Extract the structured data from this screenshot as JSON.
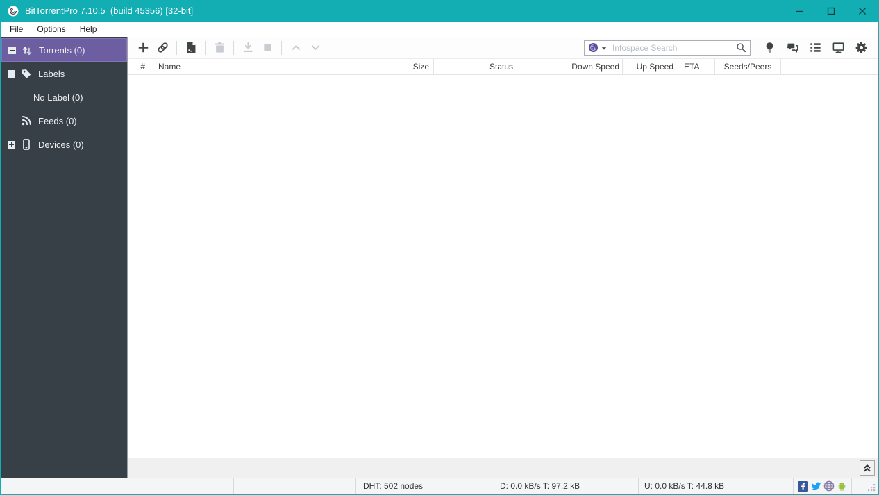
{
  "window": {
    "title": "BitTorrentPro 7.10.5  (build 45356) [32-bit]"
  },
  "menu": {
    "items": [
      {
        "label": "File"
      },
      {
        "label": "Options"
      },
      {
        "label": "Help"
      }
    ]
  },
  "sidebar": {
    "items": [
      {
        "label": "Torrents (0)",
        "icon": "updown-arrows-icon",
        "expander": "plus",
        "selected": true
      },
      {
        "label": "Labels",
        "icon": "tag-icon",
        "expander": "minus"
      },
      {
        "label": "No Label (0)",
        "icon": null,
        "indent": true
      },
      {
        "label": "Feeds (0)",
        "icon": "rss-icon"
      },
      {
        "label": "Devices (0)",
        "icon": "smartphone-icon",
        "expander": "plus"
      }
    ]
  },
  "toolbar": {
    "buttons": [
      {
        "name": "add-torrent",
        "icon": "plus-icon",
        "enabled": true
      },
      {
        "name": "add-torrent-url",
        "icon": "link-icon",
        "enabled": true
      },
      {
        "name": "create-torrent",
        "icon": "new-document-icon",
        "enabled": true
      },
      {
        "name": "remove-torrent",
        "icon": "trash-icon",
        "enabled": false
      },
      {
        "name": "start-torrent",
        "icon": "download-icon",
        "enabled": false
      },
      {
        "name": "stop-torrent",
        "icon": "stop-icon",
        "enabled": false
      },
      {
        "name": "move-up-queue",
        "icon": "chevron-up-icon",
        "enabled": false
      },
      {
        "name": "move-down-queue",
        "icon": "chevron-down-icon",
        "enabled": false
      }
    ],
    "search": {
      "placeholder": "Infospace Search",
      "value": ""
    },
    "right_buttons": [
      {
        "name": "remote",
        "icon": "lightbulb-icon"
      },
      {
        "name": "chat",
        "icon": "chat-bubbles-icon"
      },
      {
        "name": "detailed-info",
        "icon": "list-icon"
      },
      {
        "name": "devices-playback",
        "icon": "monitor-icon"
      },
      {
        "name": "preferences",
        "icon": "gear-icon"
      }
    ]
  },
  "table": {
    "columns": [
      {
        "label": "#"
      },
      {
        "label": "Name"
      },
      {
        "label": "Size"
      },
      {
        "label": "Status"
      },
      {
        "label": "Down Speed"
      },
      {
        "label": "Up Speed"
      },
      {
        "label": "ETA"
      },
      {
        "label": "Seeds/Peers"
      }
    ],
    "rows": []
  },
  "statusbar": {
    "dht": "DHT: 502 nodes",
    "download": "D: 0.0 kB/s T: 97.2 kB",
    "upload": "U: 0.0 kB/s T: 44.8 kB",
    "social_icons": [
      "facebook-icon",
      "twitter-icon",
      "globe-icon",
      "android-icon"
    ]
  },
  "colors": {
    "titlebar_teal": "#12aeb4",
    "sidebar_bg": "#374046",
    "selected_purple": "#6c5ea1",
    "search_logo_purple": "#5b4ea0",
    "facebook_blue": "#3a579a",
    "twitter_blue": "#1da1f2",
    "android_green": "#98c13d",
    "disabled_icon": "#c9cdd1",
    "enabled_icon": "#3f4447"
  }
}
